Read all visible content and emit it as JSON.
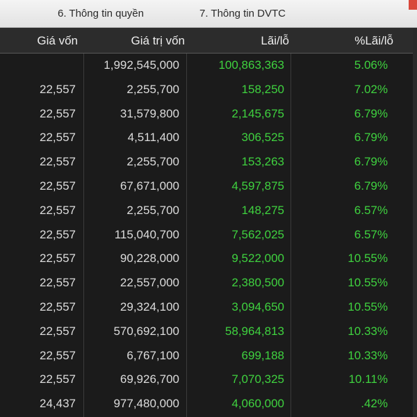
{
  "tabs": [
    {
      "label": "6. Thông tin quyền"
    },
    {
      "label": "7. Thông tin DVTC"
    }
  ],
  "columns": [
    "Giá vốn",
    "Giá trị vốn",
    "Lãi/lỗ",
    "%Lãi/lỗ"
  ],
  "rows": [
    [
      "",
      "1,992,545,000",
      "100,863,363",
      "5.06%"
    ],
    [
      "22,557",
      "2,255,700",
      "158,250",
      "7.02%"
    ],
    [
      "22,557",
      "31,579,800",
      "2,145,675",
      "6.79%"
    ],
    [
      "22,557",
      "4,511,400",
      "306,525",
      "6.79%"
    ],
    [
      "22,557",
      "2,255,700",
      "153,263",
      "6.79%"
    ],
    [
      "22,557",
      "67,671,000",
      "4,597,875",
      "6.79%"
    ],
    [
      "22,557",
      "2,255,700",
      "148,275",
      "6.57%"
    ],
    [
      "22,557",
      "115,040,700",
      "7,562,025",
      "6.57%"
    ],
    [
      "22,557",
      "90,228,000",
      "9,522,000",
      "10.55%"
    ],
    [
      "22,557",
      "22,557,000",
      "2,380,500",
      "10.55%"
    ],
    [
      "22,557",
      "29,324,100",
      "3,094,650",
      "10.55%"
    ],
    [
      "22,557",
      "570,692,100",
      "58,964,813",
      "10.33%"
    ],
    [
      "22,557",
      "6,767,100",
      "699,188",
      "10.33%"
    ],
    [
      "22,557",
      "69,926,700",
      "7,070,325",
      "10.11%"
    ],
    [
      "24,437",
      "977,480,000",
      "4,060,000",
      ".42%"
    ]
  ],
  "colors": {
    "profit": "#3fd23f",
    "neutral": "#dcdcdc",
    "background": "#1b1b1b"
  }
}
